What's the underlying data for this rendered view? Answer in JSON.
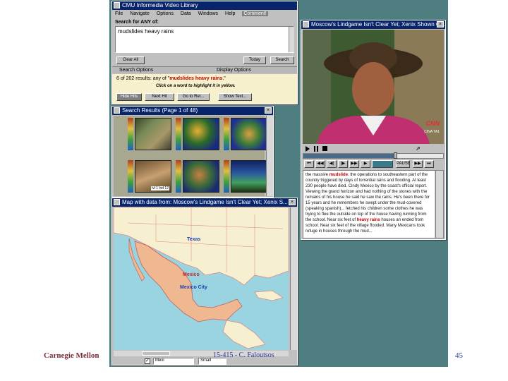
{
  "app": {
    "title": "CMU Informedia Video Library",
    "menu": [
      "File",
      "Navigate",
      "Options",
      "Data",
      "Windows",
      "Help",
      "Comment!"
    ]
  },
  "search": {
    "label": "Search for ANY of:",
    "query": "mudslides heavy rains",
    "clear_all": "Clear All",
    "today": "Today",
    "search_btn": "Search",
    "section_left": "Search Options",
    "section_right": "Display Options",
    "results_prefix": "6 of 202 results: any of \"",
    "results_terms": "mudslides heavy rains",
    "results_suffix": ".\"",
    "hint": "Click on a word to highlight it in yellow.",
    "buttons": [
      "Hide Hits",
      "Next Hit",
      "Go to Rel...",
      "Show Text..."
    ]
  },
  "results_window": {
    "title": "Search Results (Page 1 of 48)",
    "thumb_caption": "lvl 1 lnd 12"
  },
  "map_window": {
    "title": "Map with data from: Moscow's Lindgame Isn't Clear Yet; Xenix S...",
    "labels": {
      "texas": "Texas",
      "mexico": "Mexico",
      "mexico_city": "Mexico City"
    },
    "bottom_select": "Mexi",
    "bottom_select2": "Small"
  },
  "video_window": {
    "title": "Moscow's Lindgame Isn't Clear Yet; Xenix Shown we...",
    "logo": "CNN",
    "corner_text": "CINA TA1"
  },
  "transcript": {
    "lines_before": "the massive ",
    "hit1": "mudslide",
    "text1": ". the operations to southeastern part of the country triggered by days of torrential rains and flooding. At least 230 people have died. Cindy Mexico by the coast's official report. Viewing the grand horizon and had nothing of the stones with the remains of his house he said he saw the rains. He's been there for 15 years and he remembers he swept under the mud-covered (speaking spanish)... fetched his children some clothes he was trying to flee the outside on top of the house having running from the school. Near six feet of ",
    "hit2": "heavy rains",
    "text2": " houses an ended from school. Near six feet of the village flooded. Many Mexicans took refuge in houses through the mud..."
  },
  "controls": {
    "labels": [
      "",
      "",
      "",
      "",
      "",
      "",
      "",
      "",
      "PAUSE",
      "",
      "",
      ""
    ]
  },
  "footer": {
    "left": "Carnegie Mellon",
    "center": "15-415 - C. Faloutsos",
    "page": "45"
  },
  "colors": {
    "desktop": "#4e7e80",
    "titlebar": "#08246b",
    "window": "#c0c0c0",
    "mexico": "#f0b890",
    "ocean": "#9ad4e0",
    "land": "#f6f0d0",
    "label_red": "#cc2222",
    "label_blue": "#1a3fb0"
  }
}
